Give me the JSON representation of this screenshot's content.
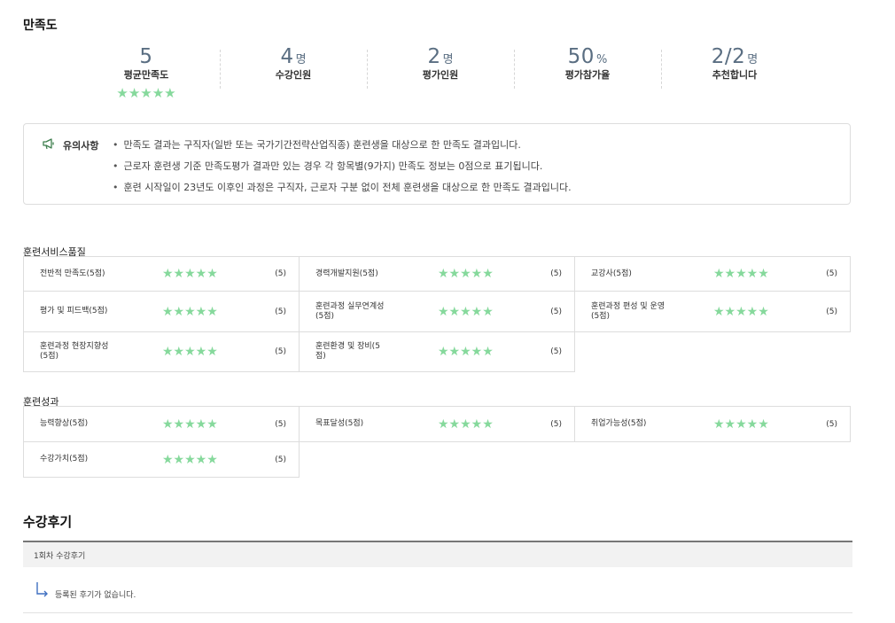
{
  "satisfaction": {
    "title": "만족도",
    "stats": [
      {
        "value": "5",
        "unit": "",
        "label": "평균만족도",
        "stars": "★★★★★"
      },
      {
        "value": "4",
        "unit": "명",
        "label": "수강인원"
      },
      {
        "value": "2",
        "unit": "명",
        "label": "평가인원"
      },
      {
        "value": "50",
        "unit": "%",
        "label": "평가참가율"
      },
      {
        "value": "2/2",
        "unit": "명",
        "label": "추천합니다"
      }
    ],
    "average_rating": 5
  },
  "notice": {
    "label": "유의사항",
    "items": [
      "만족도 결과는 구직자(일반 또는 국가기간전략산업직종) 훈련생을 대상으로 한 만족도 결과입니다.",
      "근로자 훈련생 기준 만족도평가 결과만 있는 경우 각 항목별(9가지) 만족도 정보는 0점으로 표기됩니다.",
      "훈련 시작일이 23년도 이후인 과정은 구직자, 근로자 구분 없이 전체 훈련생을 대상으로 한 만족도 결과입니다."
    ]
  },
  "groups": [
    {
      "title": "훈련서비스품질",
      "items": [
        {
          "name": "전반적 만족도(5점)",
          "stars": "★★★★★",
          "score": "(5)",
          "rating": 5
        },
        {
          "name": "경력개발지원(5점)",
          "stars": "★★★★★",
          "score": "(5)",
          "rating": 5
        },
        {
          "name": "교강사(5점)",
          "stars": "★★★★★",
          "score": "(5)",
          "rating": 5
        },
        {
          "name": "평가 및 피드백(5점)",
          "stars": "★★★★★",
          "score": "(5)",
          "rating": 5
        },
        {
          "name": "훈련과정 실무연계성(5점)",
          "stars": "★★★★★",
          "score": "(5)",
          "rating": 5
        },
        {
          "name": "훈련과정 편성 및 운영(5점)",
          "stars": "★★★★★",
          "score": "(5)",
          "rating": 5
        },
        {
          "name": "훈련과정 현장지향성(5점)",
          "stars": "★★★★★",
          "score": "(5)",
          "rating": 5
        },
        {
          "name": "훈련환경 및 장비(5점)",
          "stars": "★★★★★",
          "score": "(5)",
          "rating": 5
        }
      ]
    },
    {
      "title": "훈련성과",
      "items": [
        {
          "name": "능력향상(5점)",
          "stars": "★★★★★",
          "score": "(5)",
          "rating": 5
        },
        {
          "name": "목표달성(5점)",
          "stars": "★★★★★",
          "score": "(5)",
          "rating": 5
        },
        {
          "name": "취업가능성(5점)",
          "stars": "★★★★★",
          "score": "(5)",
          "rating": 5
        },
        {
          "name": "수강가치(5점)",
          "stars": "★★★★★",
          "score": "(5)",
          "rating": 5
        }
      ]
    }
  ],
  "reviews": {
    "title": "수강후기",
    "round_label": "1회차 수강후기",
    "empty_text": "등록된 후기가 없습니다."
  },
  "colors": {
    "star": "#86d99c",
    "stat_value": "#5a6e82",
    "notice_icon": "#3f7f4f",
    "reply_arrow": "#3f6fc0"
  },
  "icons": {
    "notice": "megaphone-icon",
    "reply": "reply-arrow-icon"
  }
}
